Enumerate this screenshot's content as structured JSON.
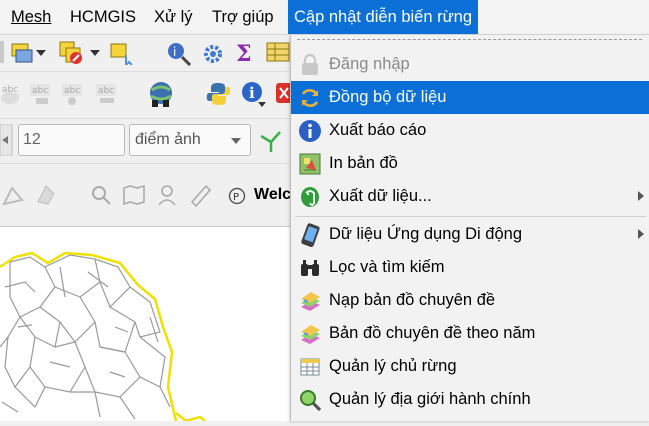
{
  "menubar": {
    "items": [
      {
        "label": "Mesh"
      },
      {
        "label": "HCMGIS"
      },
      {
        "label": "Xử lý"
      },
      {
        "label": "Trợ giúp"
      },
      {
        "label": "Cập nhật diễn biến rừng"
      }
    ]
  },
  "toolbar": {
    "size_value": "12",
    "unit_value": "điểm ảnh",
    "welcome_tab_label": "Welc"
  },
  "dropdown": {
    "items": [
      {
        "label": "Đăng nhập",
        "icon": "lock-icon",
        "state": "disabled"
      },
      {
        "label": "Đồng bộ dữ liệu",
        "icon": "sync-icon",
        "state": "highlighted"
      },
      {
        "label": "Xuất báo cáo",
        "icon": "info-icon"
      },
      {
        "label": "In bản đồ",
        "icon": "print-map-icon"
      },
      {
        "label": "Xuất dữ liệu...",
        "icon": "postgres-elephant-icon",
        "submenu": true
      },
      {
        "label": "Dữ liệu Ứng dụng Di động",
        "icon": "mobile-phone-icon",
        "submenu": true
      },
      {
        "label": "Lọc và tìm kiếm",
        "icon": "binoculars-icon"
      },
      {
        "label": "Nạp bản đồ chuyên đề",
        "icon": "thematic-map-icon"
      },
      {
        "label": "Bản đồ chuyên đề theo năm",
        "icon": "thematic-map-year-icon"
      },
      {
        "label": "Quản lý chủ rừng",
        "icon": "table-icon"
      },
      {
        "label": "Quản lý địa giới hành chính",
        "icon": "zoom-magnifier-icon"
      }
    ]
  },
  "colors": {
    "menu_highlight": "#0a6fd6",
    "map_border_yellow": "#f0e000",
    "parcel_lines": "#9a9a9a"
  }
}
